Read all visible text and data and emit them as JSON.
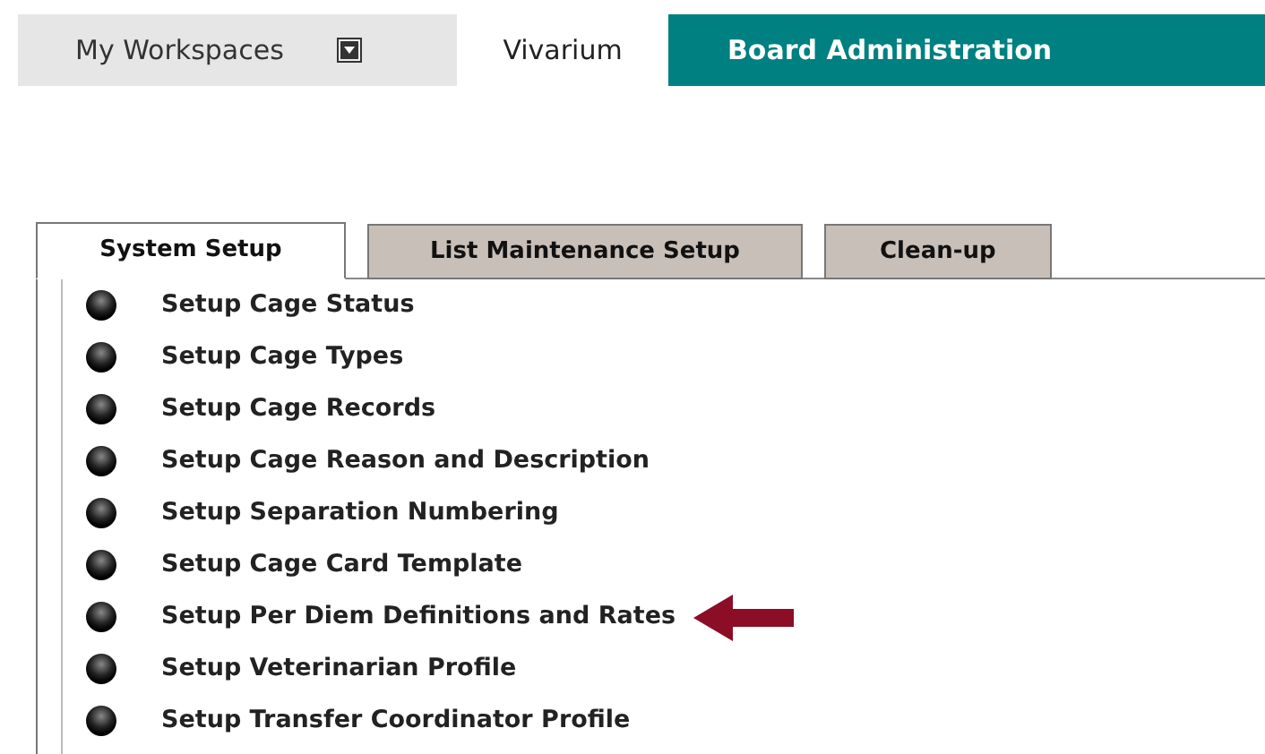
{
  "top_nav": [
    {
      "label": "My Workspaces",
      "kind": "dropdown",
      "selected": false
    },
    {
      "label": "Vivarium",
      "kind": "plain",
      "selected": false
    },
    {
      "label": "Board Administration",
      "kind": "plain",
      "selected": true
    }
  ],
  "tabs": [
    {
      "label": "System Setup",
      "selected": true
    },
    {
      "label": "List Maintenance Setup",
      "selected": false
    },
    {
      "label": "Clean-up",
      "selected": false
    }
  ],
  "setup_items": [
    {
      "label": "Setup Cage Status",
      "pointed_at": false
    },
    {
      "label": "Setup Cage Types",
      "pointed_at": false
    },
    {
      "label": "Setup Cage Records",
      "pointed_at": false
    },
    {
      "label": "Setup Cage Reason and Description",
      "pointed_at": false
    },
    {
      "label": "Setup Separation Numbering",
      "pointed_at": false
    },
    {
      "label": "Setup Cage Card Template",
      "pointed_at": false
    },
    {
      "label": "Setup Per Diem Definitions and Rates",
      "pointed_at": true
    },
    {
      "label": "Setup Veterinarian Profile",
      "pointed_at": false
    },
    {
      "label": "Setup Transfer Coordinator Profile",
      "pointed_at": false
    }
  ]
}
